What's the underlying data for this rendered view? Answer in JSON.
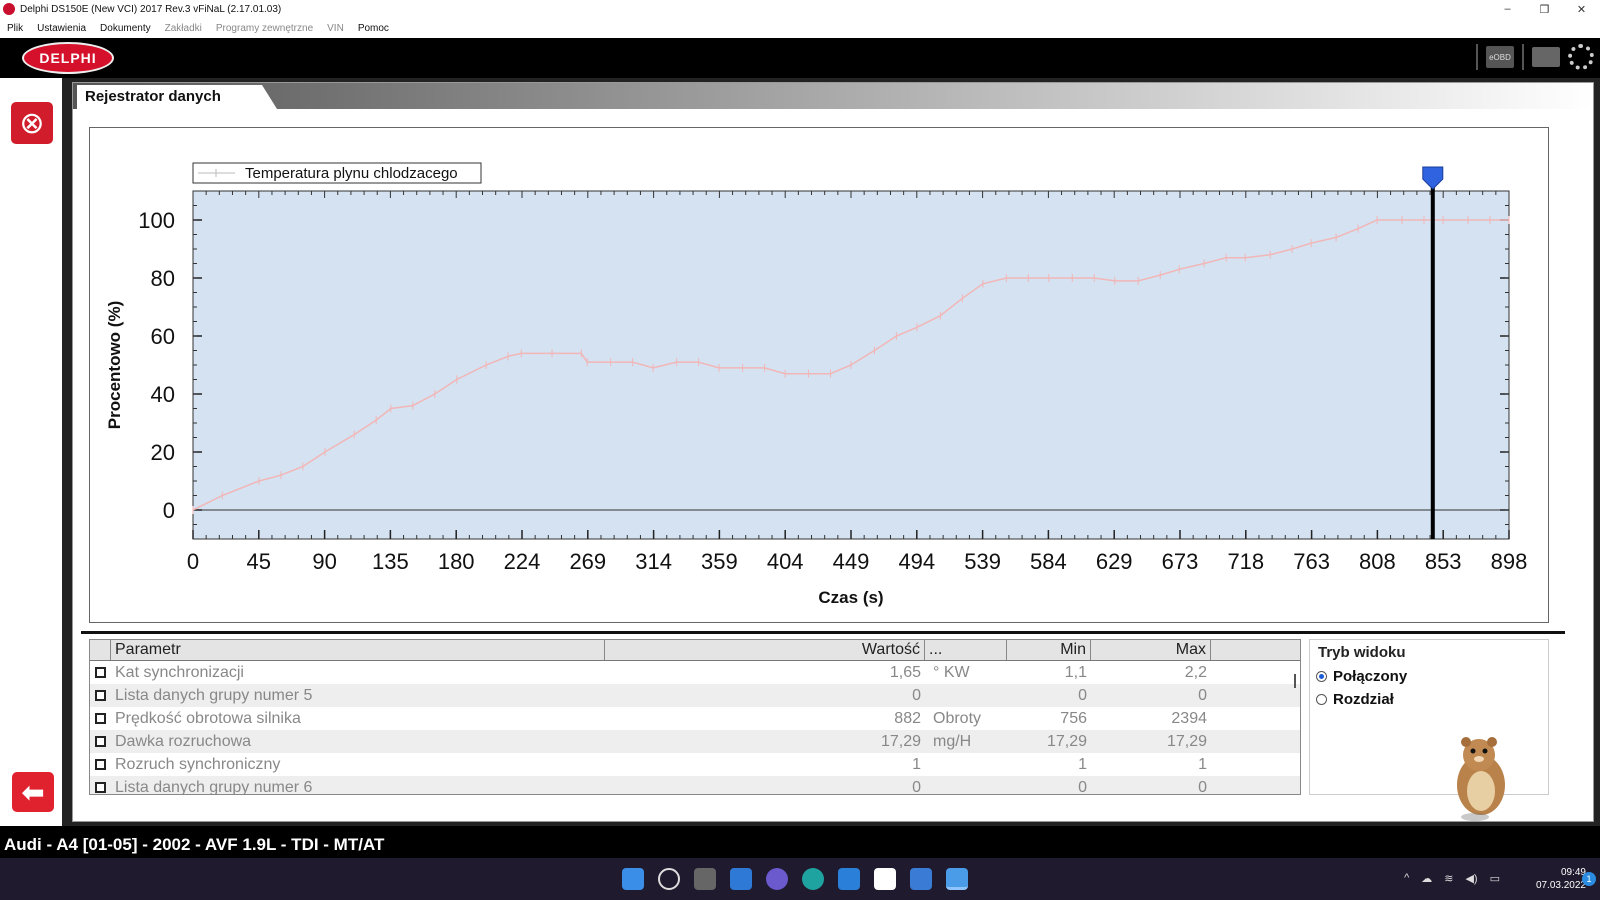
{
  "window": {
    "title": "Delphi DS150E (New VCI) 2017 Rev.3 vFiNaL (2.17.01.03)",
    "controls": [
      "–",
      "❐",
      "✕"
    ]
  },
  "menu": {
    "items": [
      {
        "label": "Plik",
        "enabled": true
      },
      {
        "label": "Ustawienia",
        "enabled": true
      },
      {
        "label": "Dokumenty",
        "enabled": true
      },
      {
        "label": "Zakładki",
        "enabled": false
      },
      {
        "label": "Programy zewnętrzne",
        "enabled": false
      },
      {
        "label": "VIN",
        "enabled": false
      },
      {
        "label": "Pomoc",
        "enabled": true
      }
    ]
  },
  "header": {
    "logo_text": "DELPHI",
    "eobd_label": "eOBD"
  },
  "tab": {
    "title": "Rejestrator danych"
  },
  "colors": {
    "plot_bg": "#d4e2f2",
    "series_line": "#f2b6b6",
    "cursor_marker": "#2f63e0",
    "brand_red": "#d4102b"
  },
  "chart_data": {
    "type": "line",
    "xlabel": "Czas (s)",
    "ylabel": "Procentowo (%)",
    "x_ticks": [
      "0",
      "45",
      "90",
      "135",
      "180",
      "224",
      "269",
      "314",
      "359",
      "404",
      "449",
      "494",
      "539",
      "584",
      "629",
      "673",
      "718",
      "763",
      "808",
      "853",
      "898"
    ],
    "y_ticks": [
      "0",
      "20",
      "40",
      "60",
      "80",
      "100"
    ],
    "xlim": [
      0,
      898
    ],
    "ylim": [
      -10,
      110
    ],
    "legend": "top-left",
    "cursor_x": 846,
    "series": [
      {
        "name": "Temperatura plynu chlodzacego",
        "x": [
          0,
          20,
          45,
          60,
          75,
          90,
          110,
          125,
          135,
          150,
          165,
          180,
          200,
          215,
          224,
          245,
          265,
          269,
          285,
          300,
          314,
          330,
          345,
          359,
          375,
          390,
          404,
          420,
          435,
          449,
          465,
          480,
          494,
          510,
          525,
          539,
          555,
          570,
          584,
          600,
          615,
          629,
          645,
          660,
          673,
          690,
          705,
          718,
          735,
          750,
          763,
          780,
          795,
          808,
          825,
          840,
          853,
          870,
          885,
          898
        ],
        "y": [
          0,
          5,
          10,
          12,
          15,
          20,
          26,
          31,
          35,
          36,
          40,
          45,
          50,
          53,
          54,
          54,
          54,
          51,
          51,
          51,
          49,
          51,
          51,
          49,
          49,
          49,
          47,
          47,
          47,
          50,
          55,
          60,
          63,
          67,
          73,
          78,
          80,
          80,
          80,
          80,
          80,
          79,
          79,
          81,
          83,
          85,
          87,
          87,
          88,
          90,
          92,
          94,
          97,
          100,
          100,
          100,
          100,
          100,
          100,
          100
        ]
      }
    ]
  },
  "table": {
    "headers": [
      "Parametr",
      "Wartość",
      "...",
      "Min",
      "Max"
    ],
    "rows": [
      {
        "name": "Kat synchronizacji",
        "value": "1,65",
        "unit": "° KW",
        "min": "1,1",
        "max": "2,2"
      },
      {
        "name": "Lista danych grupy numer 5",
        "value": "0",
        "unit": "",
        "min": "0",
        "max": "0"
      },
      {
        "name": "Prędkość obrotowa silnika",
        "value": "882",
        "unit": "Obroty",
        "min": "756",
        "max": "2394"
      },
      {
        "name": "Dawka rozruchowa",
        "value": "17,29",
        "unit": "mg/H",
        "min": "17,29",
        "max": "17,29"
      },
      {
        "name": "Rozruch synchroniczny",
        "value": "1",
        "unit": "",
        "min": "1",
        "max": "1"
      },
      {
        "name": "Lista danych grupy numer 6",
        "value": "0",
        "unit": "",
        "min": "0",
        "max": "0"
      }
    ]
  },
  "view_mode": {
    "title": "Tryb widoku",
    "options": [
      {
        "label": "Połączony",
        "selected": true
      },
      {
        "label": "Rozdział",
        "selected": false
      }
    ]
  },
  "status": {
    "vehicle": "Audi - A4 [01-05] - 2002 - AVF 1.9L - TDI - MT/AT"
  },
  "taskbar": {
    "time": "09:49",
    "date": "07.03.2022",
    "notification_count": "1"
  }
}
